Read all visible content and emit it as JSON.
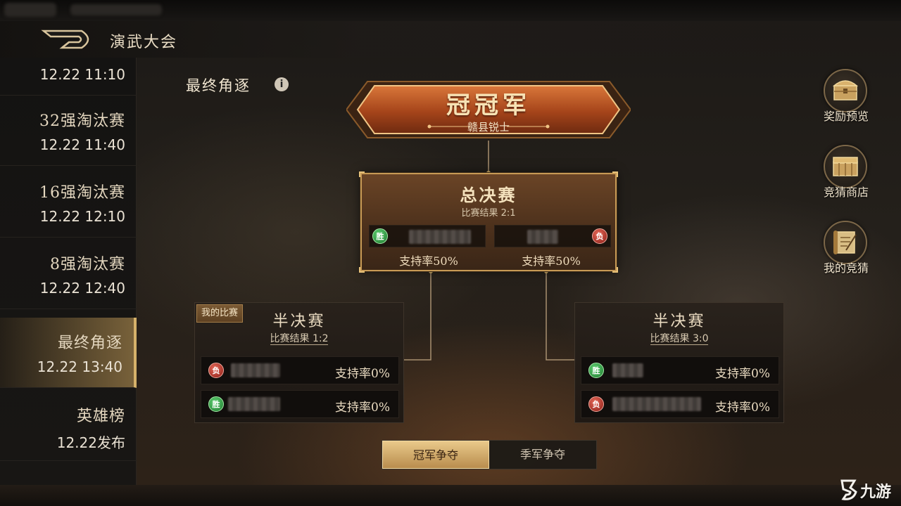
{
  "header": {
    "title": "演武大会"
  },
  "sidebar": {
    "items": [
      {
        "name": "",
        "time": "12.22 11:10"
      },
      {
        "name": "32强淘汰赛",
        "time": "12.22 11:40"
      },
      {
        "name": "16强淘汰赛",
        "time": "12.22 12:10"
      },
      {
        "name": "8强淘汰赛",
        "time": "12.22 12:40"
      },
      {
        "name": "最终角逐",
        "time": "12.22 13:40"
      },
      {
        "name": "英雄榜",
        "time": "12.22发布"
      }
    ],
    "active_index": 4
  },
  "main": {
    "section_title": "最终角逐",
    "champion": {
      "title": "冠冠军",
      "name": "赣县锐士"
    },
    "final": {
      "title": "总决赛",
      "result": "比赛结果 2:1",
      "left": {
        "badge": "胜",
        "support": "支持率50%"
      },
      "right": {
        "badge": "负",
        "support": "支持率50%"
      }
    },
    "semi_left": {
      "tag": "我的比赛",
      "title": "半决赛",
      "result": "比赛结果 1:2",
      "rows": [
        {
          "badge": "负",
          "support": "支持率0%"
        },
        {
          "badge": "胜",
          "support": "支持率0%"
        }
      ]
    },
    "semi_right": {
      "title": "半决赛",
      "result": "比赛结果 3:0",
      "rows": [
        {
          "badge": "胜",
          "support": "支持率0%"
        },
        {
          "badge": "负",
          "support": "支持率0%"
        }
      ]
    }
  },
  "right_menu": {
    "reward_preview": "奖励预览",
    "guess_shop": "竞猜商店",
    "my_guess": "我的竞猜"
  },
  "tabs": {
    "champion": "冠军争夺",
    "third_place": "季军争夺"
  },
  "watermark": {
    "text": "九游"
  },
  "colors": {
    "accent_gold": "#d6b26a",
    "win_green": "#2f9a42",
    "lose_red": "#b22a20",
    "champion_orange": "#b8521c"
  }
}
